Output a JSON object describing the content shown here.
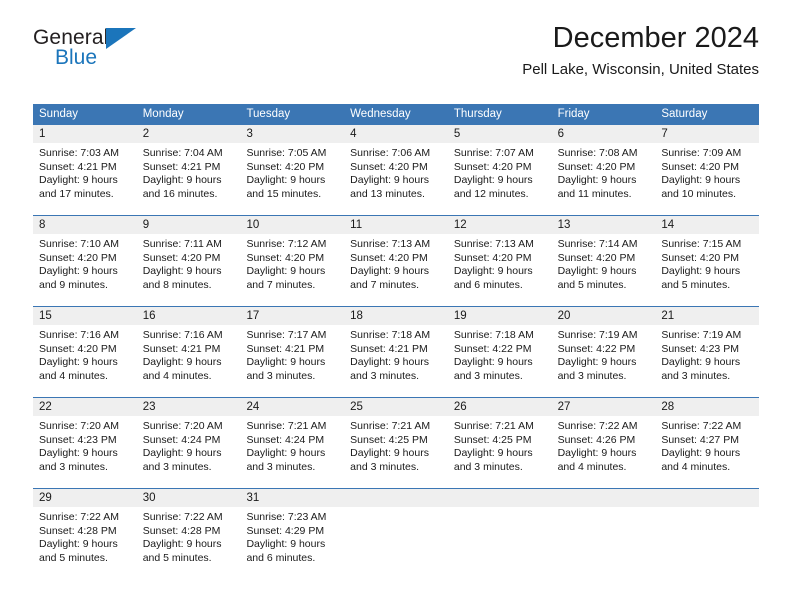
{
  "logo": {
    "text_primary": "General",
    "text_secondary": "Blue",
    "mark": "triangle-icon",
    "color_primary": "#231f20",
    "color_secondary": "#1b75bb"
  },
  "header": {
    "title": "December 2024",
    "subtitle": "Pell Lake, Wisconsin, United States"
  },
  "theme": {
    "header_bar": "#3b76b4",
    "day_band": "#efefef",
    "text": "#1a1a1a",
    "page_background": "#ffffff"
  },
  "weekdays": [
    "Sunday",
    "Monday",
    "Tuesday",
    "Wednesday",
    "Thursday",
    "Friday",
    "Saturday"
  ],
  "weeks": [
    [
      {
        "day": "1",
        "sunrise": "Sunrise: 7:03 AM",
        "sunset": "Sunset: 4:21 PM",
        "daylight_line1": "Daylight: 9 hours",
        "daylight_line2": "and 17 minutes."
      },
      {
        "day": "2",
        "sunrise": "Sunrise: 7:04 AM",
        "sunset": "Sunset: 4:21 PM",
        "daylight_line1": "Daylight: 9 hours",
        "daylight_line2": "and 16 minutes."
      },
      {
        "day": "3",
        "sunrise": "Sunrise: 7:05 AM",
        "sunset": "Sunset: 4:20 PM",
        "daylight_line1": "Daylight: 9 hours",
        "daylight_line2": "and 15 minutes."
      },
      {
        "day": "4",
        "sunrise": "Sunrise: 7:06 AM",
        "sunset": "Sunset: 4:20 PM",
        "daylight_line1": "Daylight: 9 hours",
        "daylight_line2": "and 13 minutes."
      },
      {
        "day": "5",
        "sunrise": "Sunrise: 7:07 AM",
        "sunset": "Sunset: 4:20 PM",
        "daylight_line1": "Daylight: 9 hours",
        "daylight_line2": "and 12 minutes."
      },
      {
        "day": "6",
        "sunrise": "Sunrise: 7:08 AM",
        "sunset": "Sunset: 4:20 PM",
        "daylight_line1": "Daylight: 9 hours",
        "daylight_line2": "and 11 minutes."
      },
      {
        "day": "7",
        "sunrise": "Sunrise: 7:09 AM",
        "sunset": "Sunset: 4:20 PM",
        "daylight_line1": "Daylight: 9 hours",
        "daylight_line2": "and 10 minutes."
      }
    ],
    [
      {
        "day": "8",
        "sunrise": "Sunrise: 7:10 AM",
        "sunset": "Sunset: 4:20 PM",
        "daylight_line1": "Daylight: 9 hours",
        "daylight_line2": "and 9 minutes."
      },
      {
        "day": "9",
        "sunrise": "Sunrise: 7:11 AM",
        "sunset": "Sunset: 4:20 PM",
        "daylight_line1": "Daylight: 9 hours",
        "daylight_line2": "and 8 minutes."
      },
      {
        "day": "10",
        "sunrise": "Sunrise: 7:12 AM",
        "sunset": "Sunset: 4:20 PM",
        "daylight_line1": "Daylight: 9 hours",
        "daylight_line2": "and 7 minutes."
      },
      {
        "day": "11",
        "sunrise": "Sunrise: 7:13 AM",
        "sunset": "Sunset: 4:20 PM",
        "daylight_line1": "Daylight: 9 hours",
        "daylight_line2": "and 7 minutes."
      },
      {
        "day": "12",
        "sunrise": "Sunrise: 7:13 AM",
        "sunset": "Sunset: 4:20 PM",
        "daylight_line1": "Daylight: 9 hours",
        "daylight_line2": "and 6 minutes."
      },
      {
        "day": "13",
        "sunrise": "Sunrise: 7:14 AM",
        "sunset": "Sunset: 4:20 PM",
        "daylight_line1": "Daylight: 9 hours",
        "daylight_line2": "and 5 minutes."
      },
      {
        "day": "14",
        "sunrise": "Sunrise: 7:15 AM",
        "sunset": "Sunset: 4:20 PM",
        "daylight_line1": "Daylight: 9 hours",
        "daylight_line2": "and 5 minutes."
      }
    ],
    [
      {
        "day": "15",
        "sunrise": "Sunrise: 7:16 AM",
        "sunset": "Sunset: 4:20 PM",
        "daylight_line1": "Daylight: 9 hours",
        "daylight_line2": "and 4 minutes."
      },
      {
        "day": "16",
        "sunrise": "Sunrise: 7:16 AM",
        "sunset": "Sunset: 4:21 PM",
        "daylight_line1": "Daylight: 9 hours",
        "daylight_line2": "and 4 minutes."
      },
      {
        "day": "17",
        "sunrise": "Sunrise: 7:17 AM",
        "sunset": "Sunset: 4:21 PM",
        "daylight_line1": "Daylight: 9 hours",
        "daylight_line2": "and 3 minutes."
      },
      {
        "day": "18",
        "sunrise": "Sunrise: 7:18 AM",
        "sunset": "Sunset: 4:21 PM",
        "daylight_line1": "Daylight: 9 hours",
        "daylight_line2": "and 3 minutes."
      },
      {
        "day": "19",
        "sunrise": "Sunrise: 7:18 AM",
        "sunset": "Sunset: 4:22 PM",
        "daylight_line1": "Daylight: 9 hours",
        "daylight_line2": "and 3 minutes."
      },
      {
        "day": "20",
        "sunrise": "Sunrise: 7:19 AM",
        "sunset": "Sunset: 4:22 PM",
        "daylight_line1": "Daylight: 9 hours",
        "daylight_line2": "and 3 minutes."
      },
      {
        "day": "21",
        "sunrise": "Sunrise: 7:19 AM",
        "sunset": "Sunset: 4:23 PM",
        "daylight_line1": "Daylight: 9 hours",
        "daylight_line2": "and 3 minutes."
      }
    ],
    [
      {
        "day": "22",
        "sunrise": "Sunrise: 7:20 AM",
        "sunset": "Sunset: 4:23 PM",
        "daylight_line1": "Daylight: 9 hours",
        "daylight_line2": "and 3 minutes."
      },
      {
        "day": "23",
        "sunrise": "Sunrise: 7:20 AM",
        "sunset": "Sunset: 4:24 PM",
        "daylight_line1": "Daylight: 9 hours",
        "daylight_line2": "and 3 minutes."
      },
      {
        "day": "24",
        "sunrise": "Sunrise: 7:21 AM",
        "sunset": "Sunset: 4:24 PM",
        "daylight_line1": "Daylight: 9 hours",
        "daylight_line2": "and 3 minutes."
      },
      {
        "day": "25",
        "sunrise": "Sunrise: 7:21 AM",
        "sunset": "Sunset: 4:25 PM",
        "daylight_line1": "Daylight: 9 hours",
        "daylight_line2": "and 3 minutes."
      },
      {
        "day": "26",
        "sunrise": "Sunrise: 7:21 AM",
        "sunset": "Sunset: 4:25 PM",
        "daylight_line1": "Daylight: 9 hours",
        "daylight_line2": "and 3 minutes."
      },
      {
        "day": "27",
        "sunrise": "Sunrise: 7:22 AM",
        "sunset": "Sunset: 4:26 PM",
        "daylight_line1": "Daylight: 9 hours",
        "daylight_line2": "and 4 minutes."
      },
      {
        "day": "28",
        "sunrise": "Sunrise: 7:22 AM",
        "sunset": "Sunset: 4:27 PM",
        "daylight_line1": "Daylight: 9 hours",
        "daylight_line2": "and 4 minutes."
      }
    ],
    [
      {
        "day": "29",
        "sunrise": "Sunrise: 7:22 AM",
        "sunset": "Sunset: 4:28 PM",
        "daylight_line1": "Daylight: 9 hours",
        "daylight_line2": "and 5 minutes."
      },
      {
        "day": "30",
        "sunrise": "Sunrise: 7:22 AM",
        "sunset": "Sunset: 4:28 PM",
        "daylight_line1": "Daylight: 9 hours",
        "daylight_line2": "and 5 minutes."
      },
      {
        "day": "31",
        "sunrise": "Sunrise: 7:23 AM",
        "sunset": "Sunset: 4:29 PM",
        "daylight_line1": "Daylight: 9 hours",
        "daylight_line2": "and 6 minutes."
      },
      {
        "day": "",
        "sunrise": "",
        "sunset": "",
        "daylight_line1": "",
        "daylight_line2": ""
      },
      {
        "day": "",
        "sunrise": "",
        "sunset": "",
        "daylight_line1": "",
        "daylight_line2": ""
      },
      {
        "day": "",
        "sunrise": "",
        "sunset": "",
        "daylight_line1": "",
        "daylight_line2": ""
      },
      {
        "day": "",
        "sunrise": "",
        "sunset": "",
        "daylight_line1": "",
        "daylight_line2": ""
      }
    ]
  ]
}
